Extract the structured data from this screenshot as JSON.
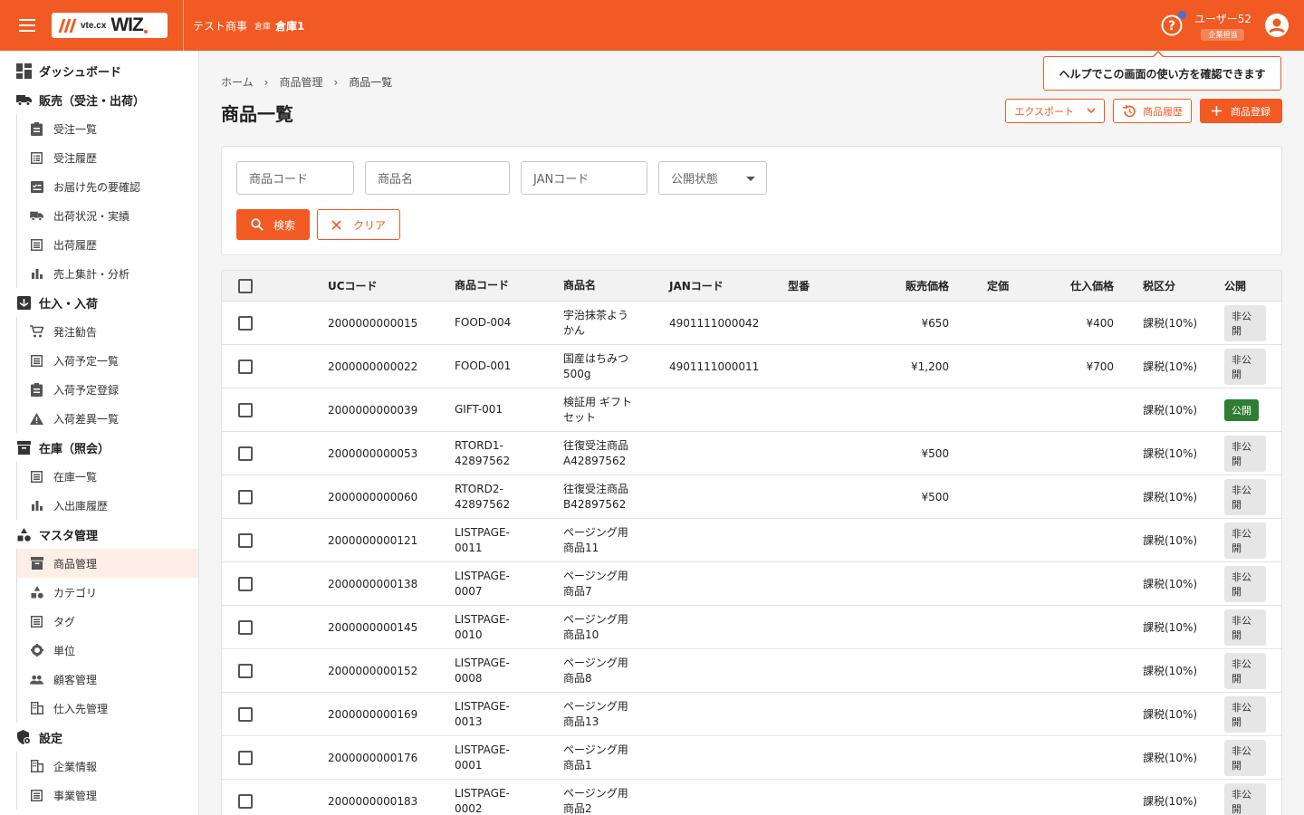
{
  "header": {
    "logo_small": "vte.cx",
    "logo_big": "WIZ",
    "company": "テスト商事",
    "warehouse_label": "倉庫",
    "warehouse_name": "倉庫1",
    "user_name": "ユーザー52",
    "user_role": "企業担当",
    "accent": "#f15a22"
  },
  "tooltip": "ヘルプでこの画面の使い方を確認できます",
  "sidebar": {
    "dashboard": "ダッシュボード",
    "sales": "販売（受注・出荷）",
    "sales_items": [
      "受注一覧",
      "受注履歴",
      "お届け先の要確認",
      "出荷状況・実績",
      "出荷履歴",
      "売上集計・分析"
    ],
    "purchase": "仕入・入荷",
    "purchase_items": [
      "発注勧告",
      "入荷予定一覧",
      "入荷予定登録",
      "入荷差異一覧"
    ],
    "stock": "在庫（照会）",
    "stock_items": [
      "在庫一覧",
      "入出庫履歴"
    ],
    "master": "マスタ管理",
    "master_items": [
      "商品管理",
      "カテゴリ",
      "タグ",
      "単位",
      "顧客管理",
      "仕入先管理"
    ],
    "settings": "設定",
    "settings_items": [
      "企業情報",
      "事業管理"
    ]
  },
  "breadcrumb": [
    "ホーム",
    "商品管理",
    "商品一覧"
  ],
  "page_title": "商品一覧",
  "actions": {
    "export": "エクスポート",
    "history": "商品履歴",
    "register": "商品登録"
  },
  "search": {
    "product_code": "商品コード",
    "product_name": "商品名",
    "jan_code": "JANコード",
    "status": "公開状態",
    "search_btn": "検索",
    "clear_btn": "クリア"
  },
  "table": {
    "headers": [
      "UCコード",
      "商品コード",
      "商品名",
      "JANコード",
      "型番",
      "販売価格",
      "定価",
      "仕入価格",
      "税区分",
      "公開"
    ],
    "rows": [
      {
        "uc": "2000000000015",
        "code": [
          "FOOD-004",
          ""
        ],
        "name": [
          "宇治抹茶よう",
          "かん"
        ],
        "jan": "4901111000042",
        "model": "",
        "price": "¥650",
        "list": "",
        "cost": "¥400",
        "tax": "課税(10%)",
        "pub": "非公開",
        "public": false
      },
      {
        "uc": "2000000000022",
        "code": [
          "FOOD-001",
          ""
        ],
        "name": [
          "国産はちみつ",
          "500g"
        ],
        "jan": "4901111000011",
        "model": "",
        "price": "¥1,200",
        "list": "",
        "cost": "¥700",
        "tax": "課税(10%)",
        "pub": "非公開",
        "public": false
      },
      {
        "uc": "2000000000039",
        "code": [
          "GIFT-001",
          ""
        ],
        "name": [
          "検証用 ギフト",
          "セット"
        ],
        "jan": "",
        "model": "",
        "price": "",
        "list": "",
        "cost": "",
        "tax": "課税(10%)",
        "pub": "公開",
        "public": true
      },
      {
        "uc": "2000000000053",
        "code": [
          "RTORD1-",
          "42897562"
        ],
        "name": [
          "往復受注商品",
          "A42897562"
        ],
        "jan": "",
        "model": "",
        "price": "¥500",
        "list": "",
        "cost": "",
        "tax": "課税(10%)",
        "pub": "非公開",
        "public": false
      },
      {
        "uc": "2000000000060",
        "code": [
          "RTORD2-",
          "42897562"
        ],
        "name": [
          "往復受注商品",
          "B42897562"
        ],
        "jan": "",
        "model": "",
        "price": "¥500",
        "list": "",
        "cost": "",
        "tax": "課税(10%)",
        "pub": "非公開",
        "public": false
      },
      {
        "uc": "2000000000121",
        "code": [
          "LISTPAGE-",
          "0011"
        ],
        "name": [
          "ページング用",
          "商品11"
        ],
        "jan": "",
        "model": "",
        "price": "",
        "list": "",
        "cost": "",
        "tax": "課税(10%)",
        "pub": "非公開",
        "public": false
      },
      {
        "uc": "2000000000138",
        "code": [
          "LISTPAGE-",
          "0007"
        ],
        "name": [
          "ページング用",
          "商品7"
        ],
        "jan": "",
        "model": "",
        "price": "",
        "list": "",
        "cost": "",
        "tax": "課税(10%)",
        "pub": "非公開",
        "public": false
      },
      {
        "uc": "2000000000145",
        "code": [
          "LISTPAGE-",
          "0010"
        ],
        "name": [
          "ページング用",
          "商品10"
        ],
        "jan": "",
        "model": "",
        "price": "",
        "list": "",
        "cost": "",
        "tax": "課税(10%)",
        "pub": "非公開",
        "public": false
      },
      {
        "uc": "2000000000152",
        "code": [
          "LISTPAGE-",
          "0008"
        ],
        "name": [
          "ページング用",
          "商品8"
        ],
        "jan": "",
        "model": "",
        "price": "",
        "list": "",
        "cost": "",
        "tax": "課税(10%)",
        "pub": "非公開",
        "public": false
      },
      {
        "uc": "2000000000169",
        "code": [
          "LISTPAGE-",
          "0013"
        ],
        "name": [
          "ページング用",
          "商品13"
        ],
        "jan": "",
        "model": "",
        "price": "",
        "list": "",
        "cost": "",
        "tax": "課税(10%)",
        "pub": "非公開",
        "public": false
      },
      {
        "uc": "2000000000176",
        "code": [
          "LISTPAGE-",
          "0001"
        ],
        "name": [
          "ページング用",
          "商品1"
        ],
        "jan": "",
        "model": "",
        "price": "",
        "list": "",
        "cost": "",
        "tax": "課税(10%)",
        "pub": "非公開",
        "public": false
      },
      {
        "uc": "2000000000183",
        "code": [
          "LISTPAGE-",
          "0002"
        ],
        "name": [
          "ページング用",
          "商品2"
        ],
        "jan": "",
        "model": "",
        "price": "",
        "list": "",
        "cost": "",
        "tax": "課税(10%)",
        "pub": "非公開",
        "public": false
      }
    ]
  }
}
